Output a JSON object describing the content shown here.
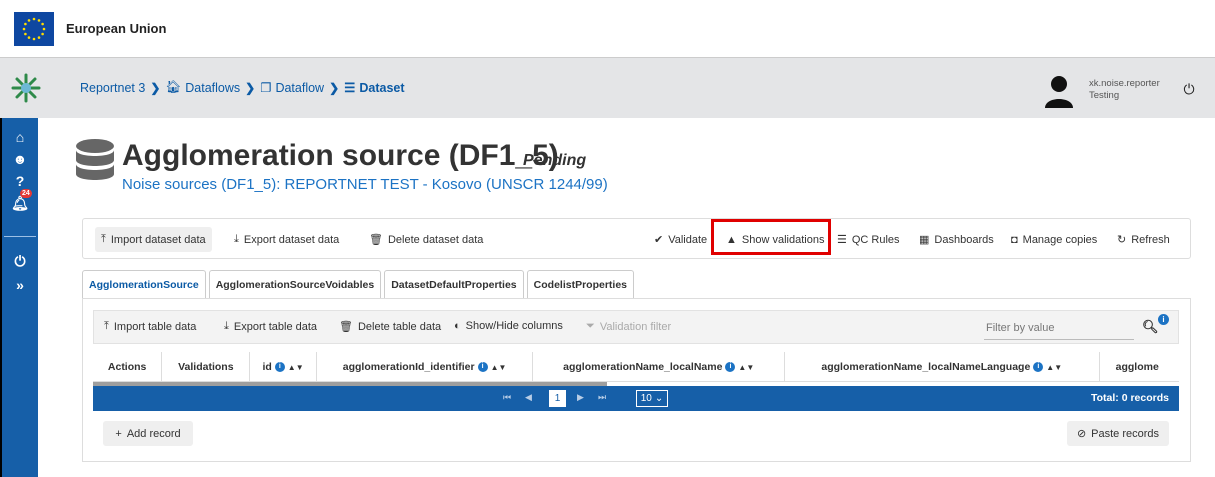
{
  "header": {
    "eu_title": "European Union"
  },
  "breadcrumb": {
    "items": [
      "Reportnet 3",
      "Dataflows",
      "Dataflow"
    ],
    "current": "Dataset"
  },
  "user": {
    "name": "xk.noise.reporter",
    "role": "Testing"
  },
  "sidebar": {
    "notification_count": "24"
  },
  "dataset": {
    "title": "Agglomeration source (DF1_5)",
    "status": "Pending",
    "subtitle": "Noise sources (DF1_5): REPORTNET TEST - Kosovo (UNSCR 1244/99)"
  },
  "toolbar": {
    "import": "Import dataset data",
    "export": "Export dataset data",
    "delete": "Delete dataset data",
    "validate": "Validate",
    "show_validations": "Show validations",
    "qc_rules": "QC Rules",
    "dashboards": "Dashboards",
    "manage_copies": "Manage copies",
    "refresh": "Refresh"
  },
  "tabs": [
    "AgglomerationSource",
    "AgglomerationSourceVoidables",
    "DatasetDefaultProperties",
    "CodelistProperties"
  ],
  "table_toolbar": {
    "import": "Import table data",
    "export": "Export table data",
    "delete": "Delete table data",
    "show_hide": "Show/Hide columns",
    "validation_filter": "Validation filter",
    "filter_placeholder": "Filter by value"
  },
  "columns": [
    "Actions",
    "Validations",
    "id",
    "agglomerationId_identifier",
    "agglomerationName_localName",
    "agglomerationName_localNameLanguage",
    "agglome"
  ],
  "paginator": {
    "page": "1",
    "rows": "10",
    "total": "Total: 0 records"
  },
  "actions": {
    "add_record": "Add record",
    "paste_records": "Paste records"
  },
  "colors": {
    "primary": "#165fa8",
    "link": "#0b5aa5",
    "highlight": "#e00000"
  }
}
